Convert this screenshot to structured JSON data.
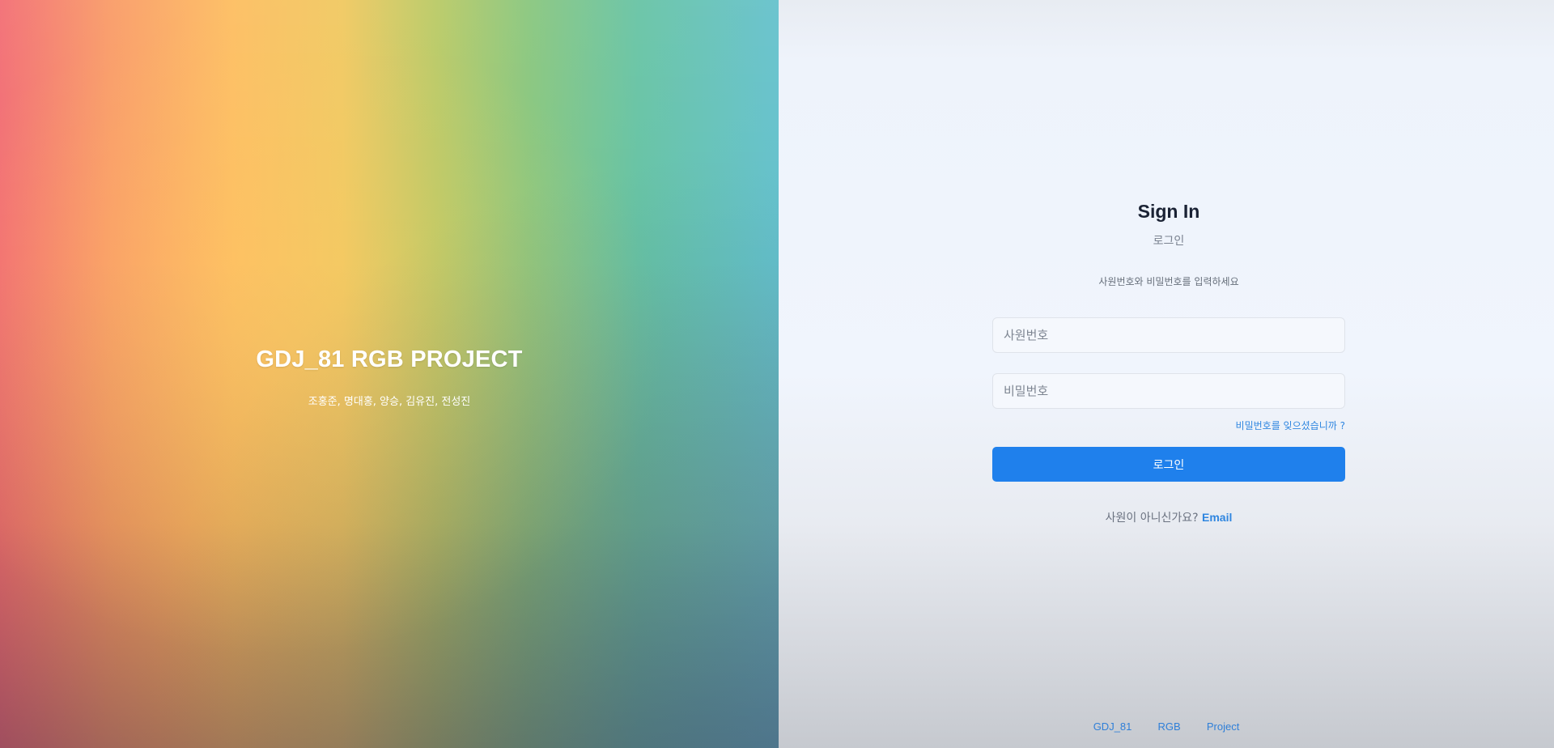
{
  "hero": {
    "title": "GDJ_81 RGB PROJECT",
    "members": "조홍준, 명대홍, 양승, 김유진, 전성진"
  },
  "auth": {
    "title": "Sign In",
    "subtitle": "로그인",
    "instruction": "사원번호와 비밀번호를 입력하세요",
    "employee_id": {
      "placeholder": "사원번호",
      "value": ""
    },
    "password": {
      "placeholder": "비밀번호",
      "value": ""
    },
    "forgot_password": "비밀번호를 잊으셨습니까 ?",
    "login_button": "로그인",
    "signup_prompt": "사원이 아니신가요?",
    "signup_link": "Email"
  },
  "footer": {
    "links": [
      "GDJ_81",
      "RGB",
      "Project"
    ]
  },
  "colors": {
    "accent": "#1f80ec",
    "link": "#2f86e0",
    "title": "#1a2234"
  }
}
